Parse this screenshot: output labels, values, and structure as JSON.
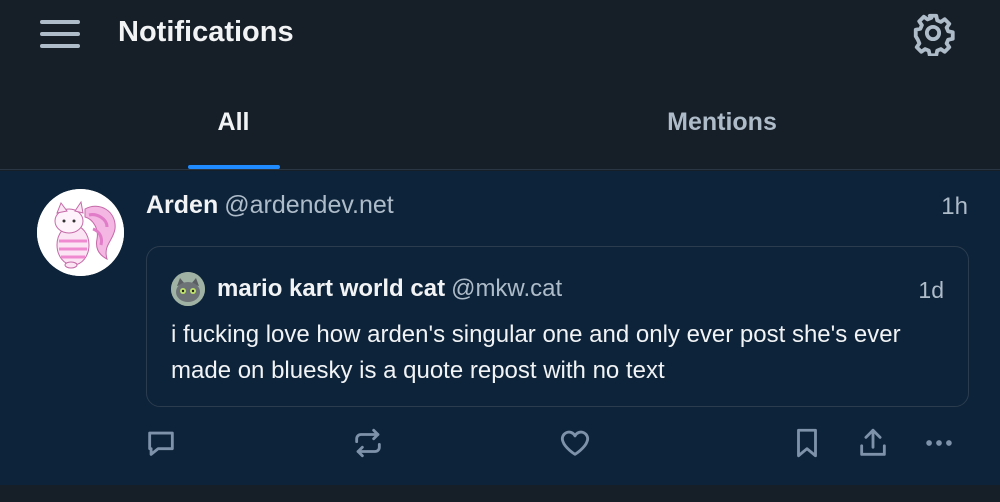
{
  "header": {
    "title": "Notifications",
    "menu_icon": "hamburger-menu-icon",
    "settings_icon": "gear-icon"
  },
  "tabs": [
    {
      "label": "All",
      "active": true
    },
    {
      "label": "Mentions",
      "active": false
    }
  ],
  "notification": {
    "author_name": "Arden",
    "author_handle": "@ardendev.net",
    "time": "1h",
    "quote": {
      "author_name": "mario kart world cat",
      "author_handle": "@mkw.cat",
      "time": "1d",
      "text": "i fucking love how arden's singular one and only ever post she's ever made on bluesky is a quote repost with no text"
    },
    "actions": [
      "reply-icon",
      "repost-icon",
      "like-icon",
      "bookmark-icon",
      "share-icon",
      "more-icon"
    ]
  },
  "colors": {
    "background": "#161e27",
    "notification_bg": "#0d2339",
    "accent": "#208bfe",
    "text_primary": "#f1f3f5",
    "text_secondary": "#aebbc9"
  }
}
